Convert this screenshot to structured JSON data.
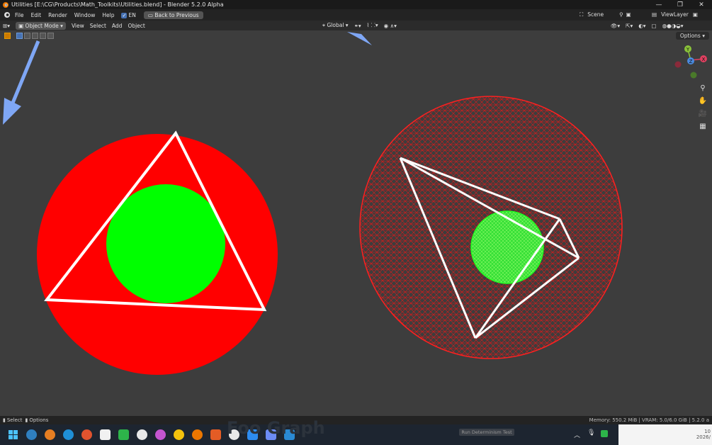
{
  "window": {
    "title": "Utilities [E:\\CG\\Products\\Math_Toolkits\\Utilities.blend] - Blender 5.2.0 Alpha",
    "controls": [
      "—",
      "❐",
      "✕"
    ]
  },
  "menubar": {
    "items": [
      "File",
      "Edit",
      "Render",
      "Window",
      "Help"
    ],
    "lang_label": "EN",
    "back_label": "Back to Previous",
    "scene_label": "Scene",
    "viewlayer_label": "ViewLayer"
  },
  "viewport_header": {
    "mode_label": "Object Mode",
    "menus": [
      "View",
      "Select",
      "Add",
      "Object"
    ],
    "transform_orientation": "Global",
    "options_label": "Options"
  },
  "gizmo": {
    "y": "Y",
    "z": "Z",
    "x": "X"
  },
  "statusbar": {
    "select_label": "Select",
    "options_label": "Options",
    "memory_text": "Memory: 550.2 MiB | VRAM: 5.0/6.0 GiB | 5.2.0 a"
  },
  "taskbar": {
    "ghost_text": "Foo Graph",
    "run_label": "Run Determinism Test",
    "clock_time": "10",
    "clock_date": "2026/"
  },
  "colors": {
    "red": "#ff0000",
    "green": "#00ff00",
    "white": "#ffffff",
    "arrow_blue": "#7fa7f5",
    "viewport_bg": "#3d3d3d"
  }
}
